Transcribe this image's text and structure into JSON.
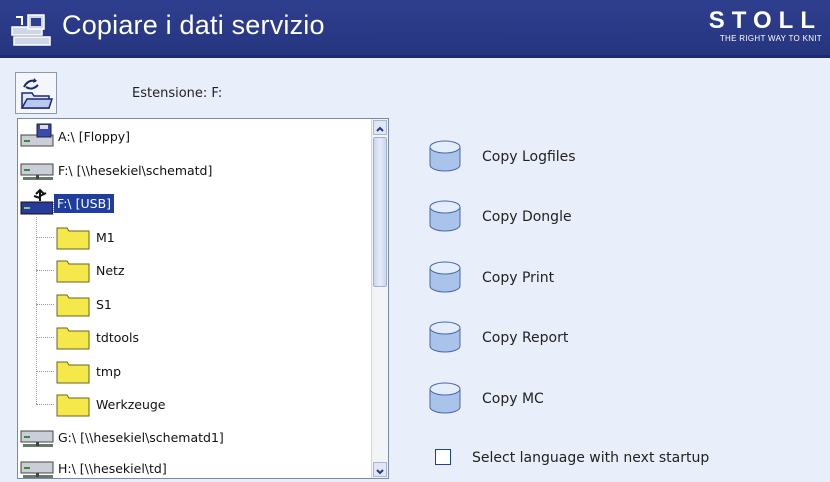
{
  "window": {
    "title": "Copiare i dati servizio"
  },
  "brand": {
    "name": "STOLL",
    "slogan": "THE RIGHT WAY TO KNIT"
  },
  "extension": {
    "label": "Estensione:  F:"
  },
  "tree": {
    "drives": [
      {
        "label": "A:\\  [Floppy]",
        "icon": "floppy-drive-icon"
      },
      {
        "label": "F:\\  [\\\\hesekiel\\schematd]",
        "icon": "network-drive-icon"
      },
      {
        "label": "F:\\  [USB]",
        "icon": "usb-drive-icon",
        "selected": true
      },
      {
        "label": "G:\\  [\\\\hesekiel\\schematd1]",
        "icon": "network-drive-icon"
      },
      {
        "label": "H:\\  [\\\\hesekiel\\td]",
        "icon": "network-drive-icon"
      }
    ],
    "folders": [
      "M1",
      "Netz",
      "S1",
      "tdtools",
      "tmp",
      "Werkzeuge"
    ]
  },
  "actions": [
    {
      "label": "Copy Logfiles"
    },
    {
      "label": "Copy Dongle"
    },
    {
      "label": "Copy Print"
    },
    {
      "label": "Copy Report"
    },
    {
      "label": "Copy MC"
    }
  ],
  "language_option": {
    "label": "Select language with next startup",
    "checked": false
  },
  "colors": {
    "titlebar": "#2a3a8a",
    "background": "#e8eefa",
    "selection": "#1e3d9e",
    "folder": "#f5e84a"
  }
}
